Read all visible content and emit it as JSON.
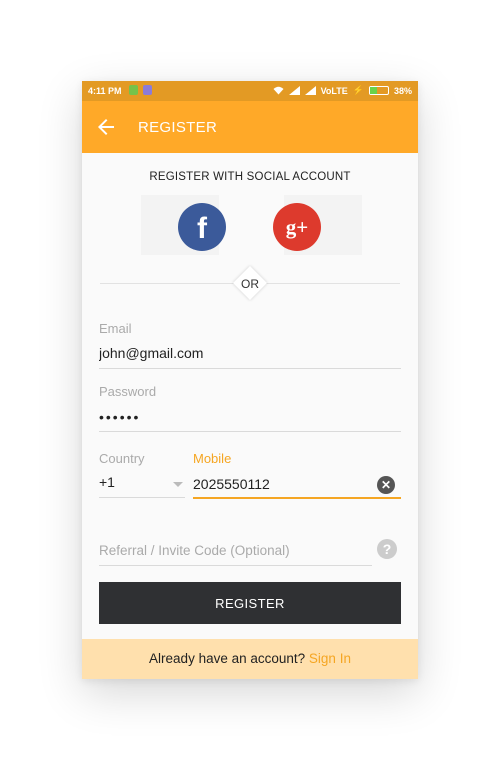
{
  "status_bar": {
    "time": "4:11 PM",
    "network": "VoLTE",
    "battery": "38%",
    "battery_level": 0.38,
    "icons": [
      "android-notification-icon",
      "app-notification-icon",
      "wifi-icon",
      "signal-icon",
      "charging-icon",
      "battery-icon"
    ]
  },
  "app_bar": {
    "back_icon": "arrow-left-icon",
    "title": "REGISTER"
  },
  "social": {
    "title": "REGISTER WITH SOCIAL ACCOUNT",
    "facebook_glyph": "f",
    "google_glyph": "g+",
    "or_label": "OR"
  },
  "form": {
    "email_label": "Email",
    "email_value": "john@gmail.com",
    "password_label": "Password",
    "password_value": "••••••",
    "country_label": "Country",
    "country_value": "+1",
    "mobile_label": "Mobile",
    "mobile_value": "2025550112",
    "clear_glyph": "✕",
    "referral_placeholder": "Referral / Invite Code (Optional)",
    "help_glyph": "?",
    "register_label": "REGISTER"
  },
  "footer": {
    "prompt": "Already have an account?",
    "signin_label": "Sign In"
  },
  "colors": {
    "accent": "#ffa928",
    "status_bar": "#e39a24",
    "facebook": "#3b5a9a",
    "google_plus": "#dd3a2d",
    "button": "#2f3033",
    "footer_bg": "#ffe0ad",
    "link": "#f5a623"
  }
}
